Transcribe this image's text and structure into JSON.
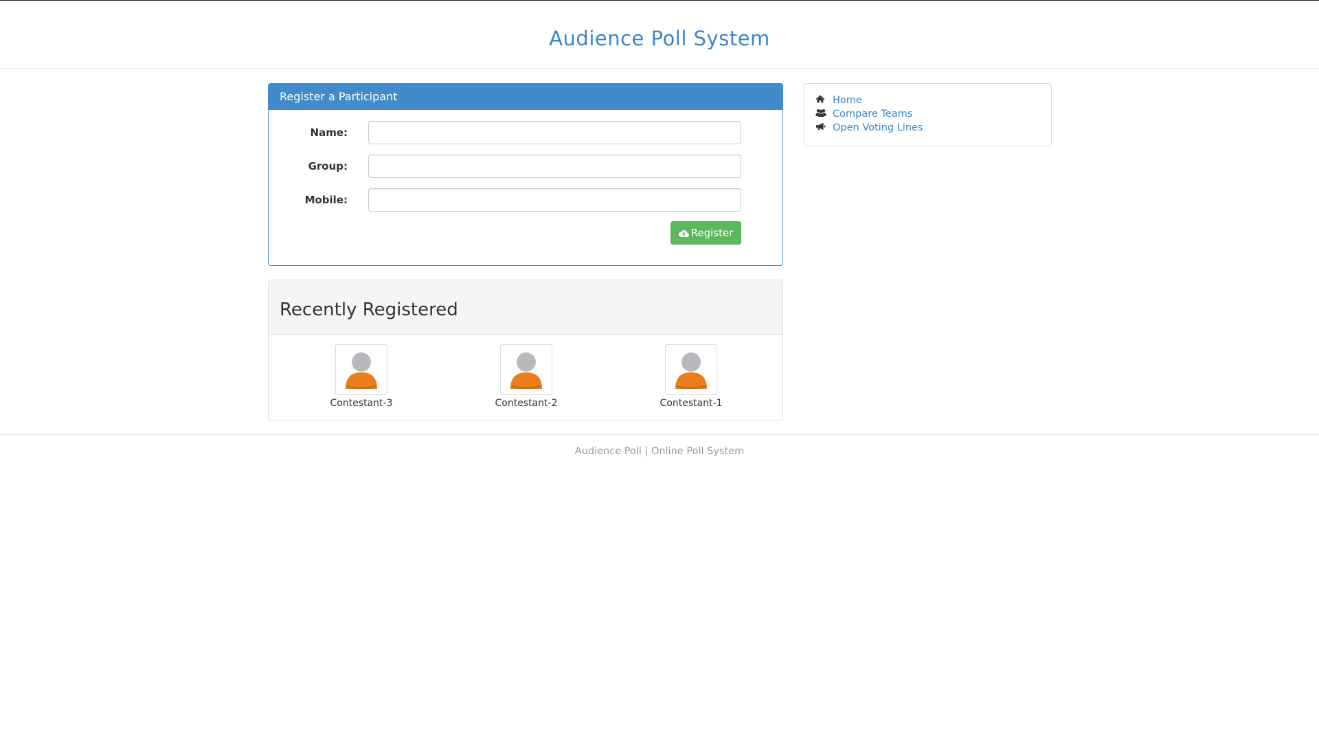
{
  "header": {
    "title": "Audience Poll System"
  },
  "register_panel": {
    "title": "Register a Participant",
    "fields": {
      "name": {
        "label": "Name:",
        "value": ""
      },
      "group": {
        "label": "Group:",
        "value": ""
      },
      "mobile": {
        "label": "Mobile:",
        "value": ""
      }
    },
    "submit_label": "Register",
    "submit_icon": "cloud-upload-icon",
    "button_color": "#5cb85c"
  },
  "recent_panel": {
    "title": "Recently Registered",
    "contestants": [
      {
        "name": "Contestant-3",
        "icon": "user-avatar-icon"
      },
      {
        "name": "Contestant-2",
        "icon": "user-avatar-icon"
      },
      {
        "name": "Contestant-1",
        "icon": "user-avatar-icon"
      }
    ]
  },
  "links": [
    {
      "label": "Home",
      "icon": "home-icon"
    },
    {
      "label": "Compare Teams",
      "icon": "users-icon"
    },
    {
      "label": "Open Voting Lines",
      "icon": "bullhorn-icon"
    }
  ],
  "footer": {
    "text": "Audience Poll | Online Poll System"
  },
  "colors": {
    "accent": "#428bca",
    "link": "#3a87c8",
    "success": "#5cb85c",
    "avatar_body": "#e87e1e",
    "avatar_head": "#b7b9bc"
  }
}
